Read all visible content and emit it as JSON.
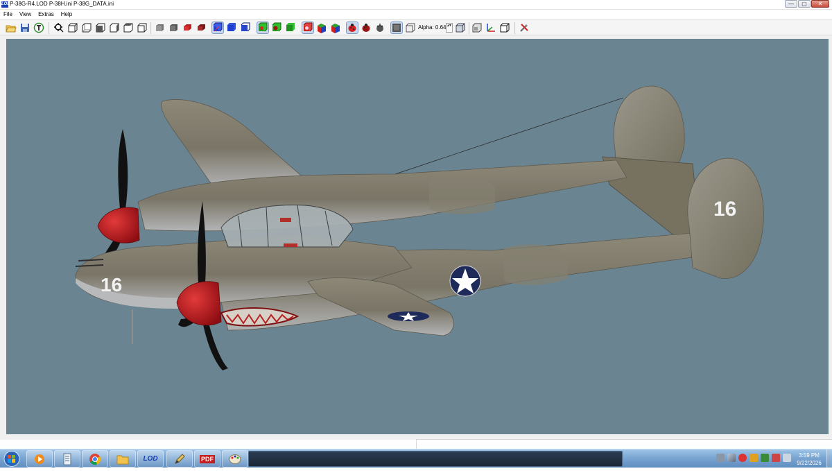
{
  "window": {
    "app_icon_text": "LOD",
    "title": "P-38G-R4.LOD  P-38H.ini  P-38G_DATA.ini",
    "minimize_glyph": "—",
    "maximize_glyph": "▢",
    "close_glyph": "✕"
  },
  "menu": {
    "items": [
      "File",
      "View",
      "Extras",
      "Help"
    ]
  },
  "toolbar": {
    "alpha_label": "Alpha: 0.64",
    "spin_glyph": "▴▾",
    "buttons": [
      "open-icon",
      "save-icon",
      "texture-icon",
      "zoom-fit-icon",
      "view-front-icon",
      "view-back-icon",
      "view-left-icon",
      "view-right-icon",
      "view-top-icon",
      "view-bottom-icon",
      "shade-gray-icon",
      "shade-dark-icon",
      "shade-red-icon",
      "shade-dark-red-icon",
      "wireframe-blue-icon",
      "solid-blue-icon",
      "outline-blue-icon",
      "green-box-icon",
      "green-sphere-icon",
      "green-cube-icon",
      "red-box-icon",
      "mixed-cube-icon",
      "normals-cube-icon",
      "red-ladybug-icon",
      "dark-ladybug-icon",
      "gear-tree-icon",
      "dark-box-icon",
      "alpha-box-icon",
      "alpha-cube-icon",
      "frame-cube-icon",
      "axes-icon",
      "outline-cube-icon",
      "tools-icon"
    ]
  },
  "aircraft": {
    "nose_number": "16",
    "tail_number": "16"
  },
  "taskbar": {
    "apps": [
      "start-orb-icon",
      "media-player-icon",
      "notepad-icon",
      "chrome-icon",
      "folder-icon",
      "lod-viewer-icon",
      "paint-pencil-icon",
      "pdf-icon",
      "paint-palette-icon"
    ],
    "lod_text": "LOD",
    "pdf_text": "PDF",
    "clock_time": "3:59 PM",
    "clock_date": "9/22/2026"
  },
  "colors": {
    "viewport_bg": "#6a8492",
    "airframe": "#7d7869",
    "spinner_red": "#c7161f"
  }
}
